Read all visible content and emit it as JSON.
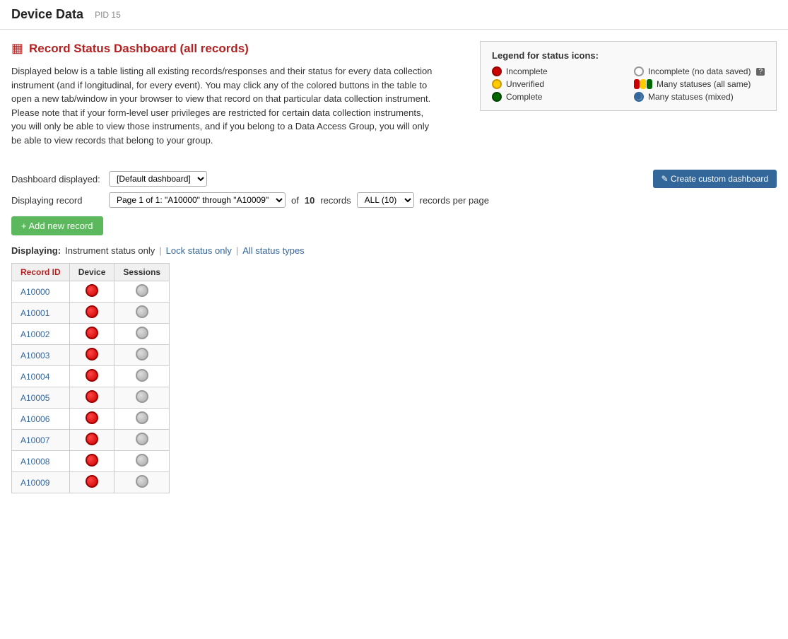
{
  "header": {
    "title": "Device Data",
    "pid_label": "PID 15"
  },
  "page": {
    "icon": "▦",
    "title": "Record Status Dashboard (all records)",
    "description": "Displayed below is a table listing all existing records/responses and their status for every data collection instrument (and if longitudinal, for every event). You may click any of the colored buttons in the table to open a new tab/window in your browser to view that record on that particular data collection instrument. Please note that if your form-level user privileges are restricted for certain data collection instruments, you will only be able to view those instruments, and if you belong to a Data Access Group, you will only be able to view records that belong to your group."
  },
  "legend": {
    "title": "Legend for status icons:",
    "items": [
      {
        "label": "Incomplete",
        "type": "red"
      },
      {
        "label": "Incomplete (no data saved)",
        "type": "gray-outline"
      },
      {
        "label": "Unverified",
        "type": "yellow"
      },
      {
        "label": "Many statuses (all same)",
        "type": "traffic"
      },
      {
        "label": "Complete",
        "type": "green"
      },
      {
        "label": "Many statuses (mixed)",
        "type": "mixed"
      }
    ]
  },
  "controls": {
    "dashboard_label": "Dashboard displayed:",
    "dashboard_value": "[Default dashboard]",
    "create_btn_label": "✎ Create custom dashboard",
    "record_label": "Displaying record",
    "record_pages": "Page 1 of 1: \"A10000\" through \"A10009\"",
    "of_label": "of",
    "record_count": "10",
    "records_label": "records",
    "per_page_label": "records per page",
    "per_page_value": "ALL (10)"
  },
  "add_record_btn": "+ Add new record",
  "displaying": {
    "label": "Displaying:",
    "instrument_status": "Instrument status only",
    "lock_status": "Lock status only",
    "all_status": "All status types",
    "sep": "|"
  },
  "table": {
    "col_record_id": "Record ID",
    "col_device": "Device",
    "col_sessions": "Sessions",
    "rows": [
      {
        "id": "A10000"
      },
      {
        "id": "A10001"
      },
      {
        "id": "A10002"
      },
      {
        "id": "A10003"
      },
      {
        "id": "A10004"
      },
      {
        "id": "A10005"
      },
      {
        "id": "A10006"
      },
      {
        "id": "A10007"
      },
      {
        "id": "A10008"
      },
      {
        "id": "A10009"
      }
    ]
  }
}
